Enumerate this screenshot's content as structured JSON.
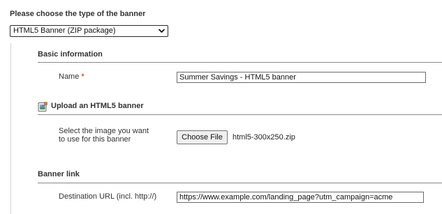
{
  "banner_type": {
    "heading": "Please choose the type of the banner",
    "selected": "HTML5 Banner (ZIP package)"
  },
  "basic_info": {
    "title": "Basic information",
    "name_label": "Name",
    "required_mark": "*",
    "name_value": "Summer Savings - HTML5 banner"
  },
  "upload": {
    "title": "Upload an HTML5 banner",
    "image_label_line1": "Select the image you want",
    "image_label_line2": "to use for this banner",
    "choose_file_label": "Choose File",
    "file_name": "html5-300x250.zip"
  },
  "banner_link": {
    "title": "Banner link",
    "url_label": "Destination URL (incl. http://)",
    "url_value": "https://www.example.com/landing_page?utm_campaign=acme"
  }
}
